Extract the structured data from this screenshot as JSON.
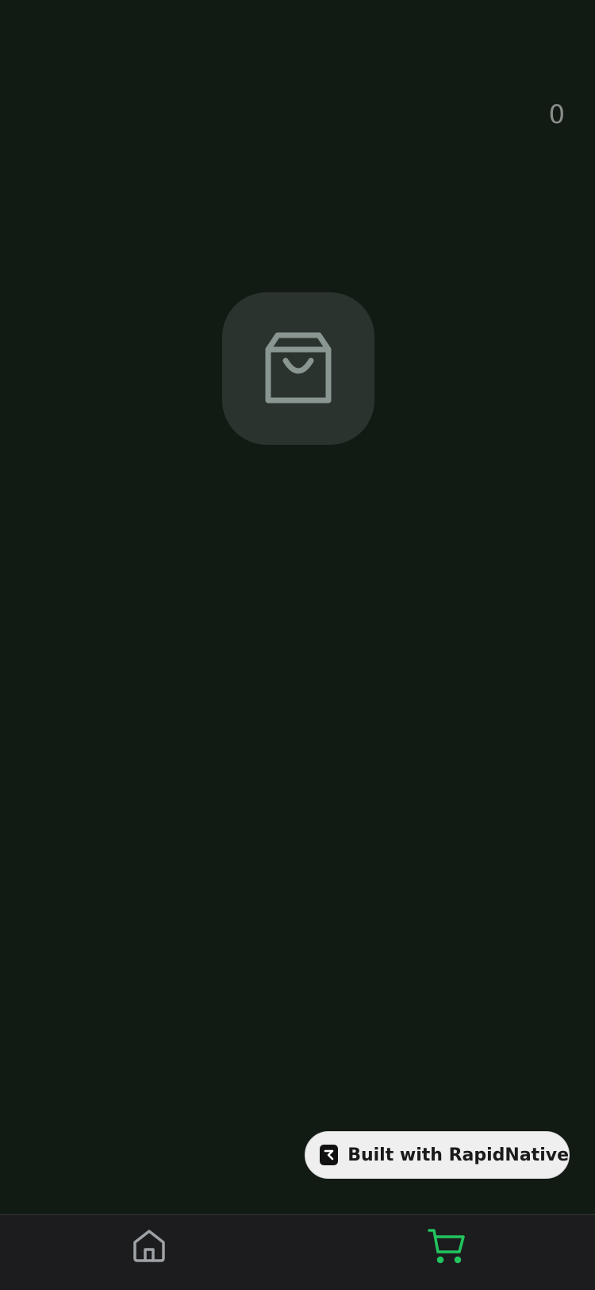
{
  "header": {
    "cart_count": "0"
  },
  "empty_state": {
    "icon": "shopping-bag-icon"
  },
  "badge": {
    "text": "Built with RapidNative",
    "icon": "rapidnative-logo-icon"
  },
  "tab_bar": {
    "tabs": [
      {
        "id": "home",
        "icon": "home-icon",
        "active": false
      },
      {
        "id": "cart",
        "icon": "cart-icon",
        "active": true
      }
    ]
  },
  "colors": {
    "background": "#121a14",
    "icon_box": "#2b332e",
    "icon_muted": "#8a9691",
    "accent": "#22c55e",
    "tab_bar": "#1c1c1e",
    "inactive_tab_icon": "#9ea1a6"
  }
}
